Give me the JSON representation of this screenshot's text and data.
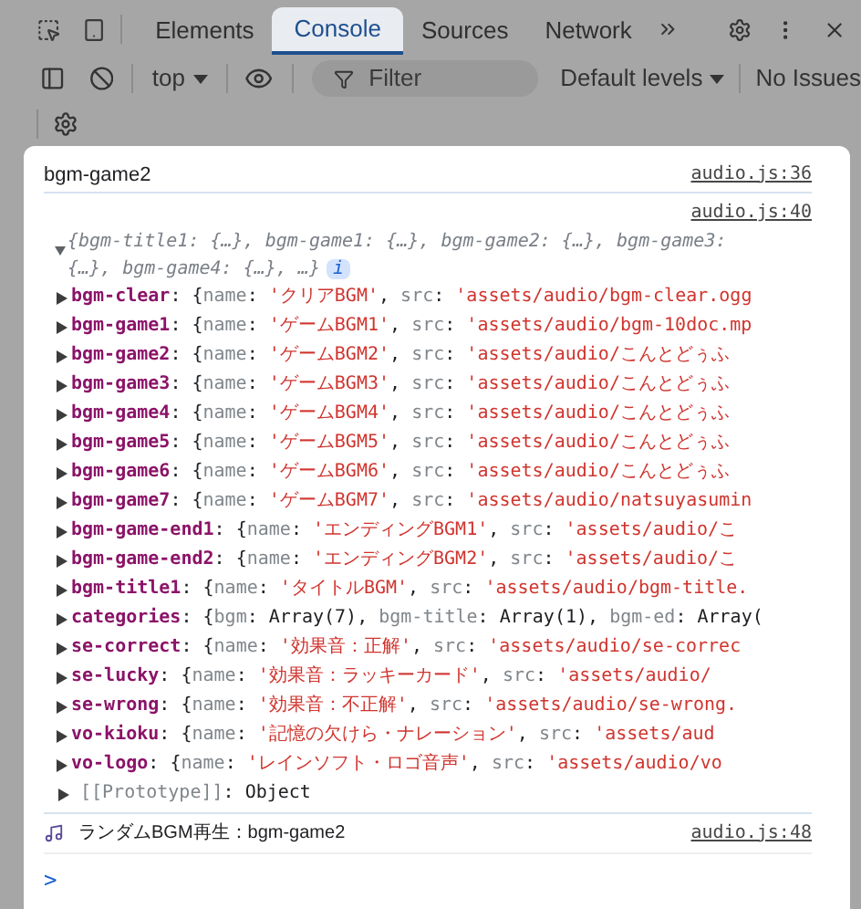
{
  "toolbar": {
    "tabs": [
      {
        "label": "Elements",
        "selected": false
      },
      {
        "label": "Console",
        "selected": true
      },
      {
        "label": "Sources",
        "selected": false
      },
      {
        "label": "Network",
        "selected": false
      }
    ],
    "context": "top",
    "filter": {
      "placeholder": "Filter"
    },
    "levels": "Default levels",
    "issues": "No Issues"
  },
  "console": {
    "messages": [
      {
        "kind": "log",
        "text": "bgm-game2",
        "source": "audio.js:36"
      },
      {
        "kind": "object",
        "source": "audio.js:40",
        "expanded": true,
        "summary": [
          "{bgm-title1: {…}, bgm-game1: {…}, bgm-game2: {…}, bgm-game3:",
          "{…}, bgm-game4: {…}, …}"
        ],
        "info": "i",
        "entries": [
          {
            "expanded": false,
            "segments": [
              {
                "kind": "key",
                "text": "bgm-clear"
              },
              {
                "kind": "punct",
                "text": ": {"
              },
              {
                "kind": "prop",
                "text": "name"
              },
              {
                "kind": "punct",
                "text": ": "
              },
              {
                "kind": "string",
                "text": "'クリアBGM'"
              },
              {
                "kind": "punct",
                "text": ", "
              },
              {
                "kind": "prop",
                "text": "src"
              },
              {
                "kind": "punct",
                "text": ": "
              },
              {
                "kind": "string",
                "text": "'assets/audio/bgm-clear.ogg"
              }
            ]
          },
          {
            "expanded": false,
            "segments": [
              {
                "kind": "key",
                "text": "bgm-game1"
              },
              {
                "kind": "punct",
                "text": ": {"
              },
              {
                "kind": "prop",
                "text": "name"
              },
              {
                "kind": "punct",
                "text": ": "
              },
              {
                "kind": "string",
                "text": "'ゲームBGM1'"
              },
              {
                "kind": "punct",
                "text": ", "
              },
              {
                "kind": "prop",
                "text": "src"
              },
              {
                "kind": "punct",
                "text": ": "
              },
              {
                "kind": "string",
                "text": "'assets/audio/bgm-10doc.mp"
              }
            ]
          },
          {
            "expanded": false,
            "segments": [
              {
                "kind": "key",
                "text": "bgm-game2"
              },
              {
                "kind": "punct",
                "text": ": {"
              },
              {
                "kind": "prop",
                "text": "name"
              },
              {
                "kind": "punct",
                "text": ": "
              },
              {
                "kind": "string",
                "text": "'ゲームBGM2'"
              },
              {
                "kind": "punct",
                "text": ", "
              },
              {
                "kind": "prop",
                "text": "src"
              },
              {
                "kind": "punct",
                "text": ": "
              },
              {
                "kind": "string",
                "text": "'assets/audio/こんとどぅふ"
              }
            ]
          },
          {
            "expanded": false,
            "segments": [
              {
                "kind": "key",
                "text": "bgm-game3"
              },
              {
                "kind": "punct",
                "text": ": {"
              },
              {
                "kind": "prop",
                "text": "name"
              },
              {
                "kind": "punct",
                "text": ": "
              },
              {
                "kind": "string",
                "text": "'ゲームBGM3'"
              },
              {
                "kind": "punct",
                "text": ", "
              },
              {
                "kind": "prop",
                "text": "src"
              },
              {
                "kind": "punct",
                "text": ": "
              },
              {
                "kind": "string",
                "text": "'assets/audio/こんとどぅふ"
              }
            ]
          },
          {
            "expanded": false,
            "segments": [
              {
                "kind": "key",
                "text": "bgm-game4"
              },
              {
                "kind": "punct",
                "text": ": {"
              },
              {
                "kind": "prop",
                "text": "name"
              },
              {
                "kind": "punct",
                "text": ": "
              },
              {
                "kind": "string",
                "text": "'ゲームBGM4'"
              },
              {
                "kind": "punct",
                "text": ", "
              },
              {
                "kind": "prop",
                "text": "src"
              },
              {
                "kind": "punct",
                "text": ": "
              },
              {
                "kind": "string",
                "text": "'assets/audio/こんとどぅふ"
              }
            ]
          },
          {
            "expanded": false,
            "segments": [
              {
                "kind": "key",
                "text": "bgm-game5"
              },
              {
                "kind": "punct",
                "text": ": {"
              },
              {
                "kind": "prop",
                "text": "name"
              },
              {
                "kind": "punct",
                "text": ": "
              },
              {
                "kind": "string",
                "text": "'ゲームBGM5'"
              },
              {
                "kind": "punct",
                "text": ", "
              },
              {
                "kind": "prop",
                "text": "src"
              },
              {
                "kind": "punct",
                "text": ": "
              },
              {
                "kind": "string",
                "text": "'assets/audio/こんとどぅふ"
              }
            ]
          },
          {
            "expanded": false,
            "segments": [
              {
                "kind": "key",
                "text": "bgm-game6"
              },
              {
                "kind": "punct",
                "text": ": {"
              },
              {
                "kind": "prop",
                "text": "name"
              },
              {
                "kind": "punct",
                "text": ": "
              },
              {
                "kind": "string",
                "text": "'ゲームBGM6'"
              },
              {
                "kind": "punct",
                "text": ", "
              },
              {
                "kind": "prop",
                "text": "src"
              },
              {
                "kind": "punct",
                "text": ": "
              },
              {
                "kind": "string",
                "text": "'assets/audio/こんとどぅふ"
              }
            ]
          },
          {
            "expanded": false,
            "segments": [
              {
                "kind": "key",
                "text": "bgm-game7"
              },
              {
                "kind": "punct",
                "text": ": {"
              },
              {
                "kind": "prop",
                "text": "name"
              },
              {
                "kind": "punct",
                "text": ": "
              },
              {
                "kind": "string",
                "text": "'ゲームBGM7'"
              },
              {
                "kind": "punct",
                "text": ", "
              },
              {
                "kind": "prop",
                "text": "src"
              },
              {
                "kind": "punct",
                "text": ": "
              },
              {
                "kind": "string",
                "text": "'assets/audio/natsuyasumin"
              }
            ]
          },
          {
            "expanded": false,
            "segments": [
              {
                "kind": "key",
                "text": "bgm-game-end1"
              },
              {
                "kind": "punct",
                "text": ": {"
              },
              {
                "kind": "prop",
                "text": "name"
              },
              {
                "kind": "punct",
                "text": ": "
              },
              {
                "kind": "string",
                "text": "'エンディングBGM1'"
              },
              {
                "kind": "punct",
                "text": ", "
              },
              {
                "kind": "prop",
                "text": "src"
              },
              {
                "kind": "punct",
                "text": ": "
              },
              {
                "kind": "string",
                "text": "'assets/audio/こ"
              }
            ]
          },
          {
            "expanded": false,
            "segments": [
              {
                "kind": "key",
                "text": "bgm-game-end2"
              },
              {
                "kind": "punct",
                "text": ": {"
              },
              {
                "kind": "prop",
                "text": "name"
              },
              {
                "kind": "punct",
                "text": ": "
              },
              {
                "kind": "string",
                "text": "'エンディングBGM2'"
              },
              {
                "kind": "punct",
                "text": ", "
              },
              {
                "kind": "prop",
                "text": "src"
              },
              {
                "kind": "punct",
                "text": ": "
              },
              {
                "kind": "string",
                "text": "'assets/audio/こ"
              }
            ]
          },
          {
            "expanded": false,
            "segments": [
              {
                "kind": "key",
                "text": "bgm-title1"
              },
              {
                "kind": "punct",
                "text": ": {"
              },
              {
                "kind": "prop",
                "text": "name"
              },
              {
                "kind": "punct",
                "text": ": "
              },
              {
                "kind": "string",
                "text": "'タイトルBGM'"
              },
              {
                "kind": "punct",
                "text": ", "
              },
              {
                "kind": "prop",
                "text": "src"
              },
              {
                "kind": "punct",
                "text": ": "
              },
              {
                "kind": "string",
                "text": "'assets/audio/bgm-title."
              }
            ]
          },
          {
            "expanded": false,
            "segments": [
              {
                "kind": "key",
                "text": "categories"
              },
              {
                "kind": "punct",
                "text": ": {"
              },
              {
                "kind": "prop",
                "text": "bgm"
              },
              {
                "kind": "punct",
                "text": ": "
              },
              {
                "kind": "plain",
                "text": "Array(7)"
              },
              {
                "kind": "punct",
                "text": ", "
              },
              {
                "kind": "prop",
                "text": "bgm-title"
              },
              {
                "kind": "punct",
                "text": ": "
              },
              {
                "kind": "plain",
                "text": "Array(1)"
              },
              {
                "kind": "punct",
                "text": ", "
              },
              {
                "kind": "prop",
                "text": "bgm-ed"
              },
              {
                "kind": "punct",
                "text": ": "
              },
              {
                "kind": "plain",
                "text": "Array("
              }
            ]
          },
          {
            "expanded": false,
            "segments": [
              {
                "kind": "key",
                "text": "se-correct"
              },
              {
                "kind": "punct",
                "text": ": {"
              },
              {
                "kind": "prop",
                "text": "name"
              },
              {
                "kind": "punct",
                "text": ": "
              },
              {
                "kind": "string",
                "text": "'効果音：正解'"
              },
              {
                "kind": "punct",
                "text": ", "
              },
              {
                "kind": "prop",
                "text": "src"
              },
              {
                "kind": "punct",
                "text": ": "
              },
              {
                "kind": "string",
                "text": "'assets/audio/se-correc"
              }
            ]
          },
          {
            "expanded": false,
            "segments": [
              {
                "kind": "key",
                "text": "se-lucky"
              },
              {
                "kind": "punct",
                "text": ": {"
              },
              {
                "kind": "prop",
                "text": "name"
              },
              {
                "kind": "punct",
                "text": ": "
              },
              {
                "kind": "string",
                "text": "'効果音：ラッキーカード'"
              },
              {
                "kind": "punct",
                "text": ", "
              },
              {
                "kind": "prop",
                "text": "src"
              },
              {
                "kind": "punct",
                "text": ": "
              },
              {
                "kind": "string",
                "text": "'assets/audio/"
              }
            ]
          },
          {
            "expanded": false,
            "segments": [
              {
                "kind": "key",
                "text": "se-wrong"
              },
              {
                "kind": "punct",
                "text": ": {"
              },
              {
                "kind": "prop",
                "text": "name"
              },
              {
                "kind": "punct",
                "text": ": "
              },
              {
                "kind": "string",
                "text": "'効果音：不正解'"
              },
              {
                "kind": "punct",
                "text": ", "
              },
              {
                "kind": "prop",
                "text": "src"
              },
              {
                "kind": "punct",
                "text": ": "
              },
              {
                "kind": "string",
                "text": "'assets/audio/se-wrong."
              }
            ]
          },
          {
            "expanded": false,
            "segments": [
              {
                "kind": "key",
                "text": "vo-kioku"
              },
              {
                "kind": "punct",
                "text": ": {"
              },
              {
                "kind": "prop",
                "text": "name"
              },
              {
                "kind": "punct",
                "text": ": "
              },
              {
                "kind": "string",
                "text": "'記憶の欠けら・ナレーション'"
              },
              {
                "kind": "punct",
                "text": ", "
              },
              {
                "kind": "prop",
                "text": "src"
              },
              {
                "kind": "punct",
                "text": ": "
              },
              {
                "kind": "string",
                "text": "'assets/aud"
              }
            ]
          },
          {
            "expanded": false,
            "segments": [
              {
                "kind": "key",
                "text": "vo-logo"
              },
              {
                "kind": "punct",
                "text": ": {"
              },
              {
                "kind": "prop",
                "text": "name"
              },
              {
                "kind": "punct",
                "text": ": "
              },
              {
                "kind": "string",
                "text": "'レインソフト・ロゴ音声'"
              },
              {
                "kind": "punct",
                "text": ", "
              },
              {
                "kind": "prop",
                "text": "src"
              },
              {
                "kind": "punct",
                "text": ": "
              },
              {
                "kind": "string",
                "text": "'assets/audio/vo"
              }
            ]
          },
          {
            "expanded": false,
            "segments": [
              {
                "kind": "prop",
                "text": "[[Prototype]]"
              },
              {
                "kind": "punct",
                "text": ": "
              },
              {
                "kind": "plain",
                "text": "Object"
              }
            ]
          }
        ]
      },
      {
        "kind": "note-log",
        "text": "ランダムBGM再生：bgm-game2",
        "source": "audio.js:48"
      }
    ],
    "prompt": ">"
  }
}
